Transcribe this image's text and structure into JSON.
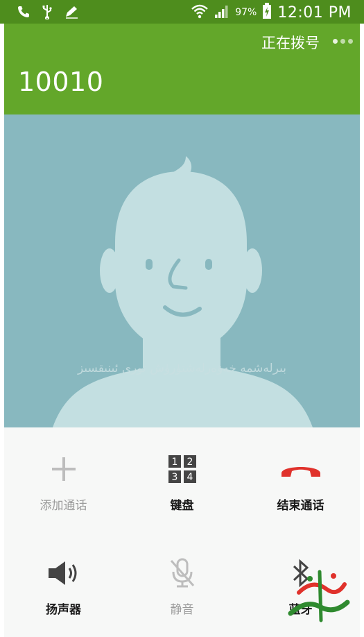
{
  "status_bar": {
    "battery": "97%",
    "time": "12:01 PM",
    "left_icons": [
      "phone-icon",
      "usb-icon",
      "edit-icon"
    ],
    "right_icons": [
      "wifi-icon",
      "signal-icon",
      "battery-charging-icon"
    ]
  },
  "call": {
    "status_label": "正在拨号",
    "number": "10010"
  },
  "photo": {
    "watermark": "بىرلەشمە خەۋەرلەشتۈرۈش تورى ئىنىقسىز"
  },
  "controls": {
    "add_call": "添加通话",
    "keypad": "键盘",
    "end_call": "结束通话",
    "speaker": "扬声器",
    "mute": "静音",
    "bluetooth": "蓝牙"
  },
  "keypad_digits": [
    "1",
    "2",
    "3",
    "4"
  ],
  "colors": {
    "status_bar": "#4e8d1d",
    "header": "#63a72a",
    "photo_bg": "#88b8bf",
    "end_call_red": "#e0322c"
  }
}
